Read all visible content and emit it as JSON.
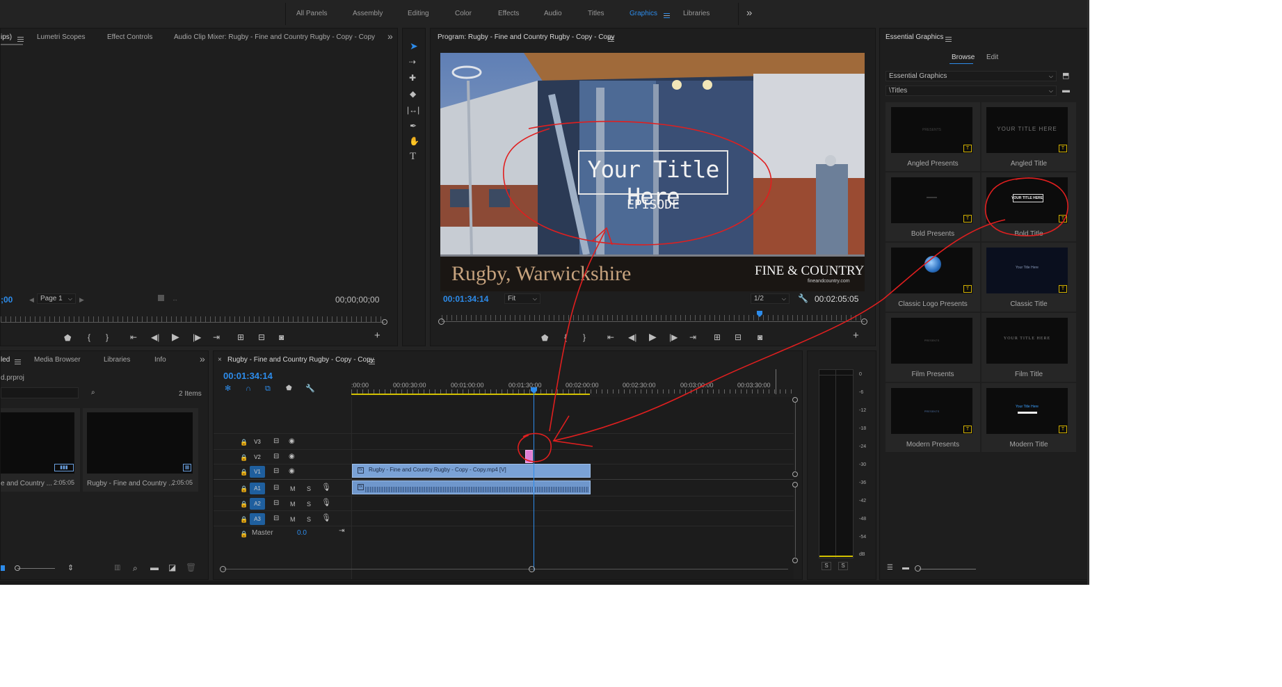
{
  "workspaces": [
    {
      "label": "All Panels",
      "active": false
    },
    {
      "label": "Assembly",
      "active": false
    },
    {
      "label": "Editing",
      "active": false
    },
    {
      "label": "Color",
      "active": false
    },
    {
      "label": "Effects",
      "active": false
    },
    {
      "label": "Audio",
      "active": false
    },
    {
      "label": "Titles",
      "active": false
    },
    {
      "label": "Graphics",
      "active": true
    },
    {
      "label": "Libraries",
      "active": false
    }
  ],
  "workspace_more": "»",
  "source_panel": {
    "tabs": [
      "ips)",
      "Lumetri Scopes",
      "Effect Controls",
      "Audio Clip Mixer: Rugby - Fine and Country Rugby - Copy - Copy"
    ],
    "more": "»",
    "timecode_left": ";00",
    "page_select": "Page 1",
    "timecode_right": "00;00;00;00"
  },
  "program_monitor": {
    "title": "Program: Rugby - Fine and Country Rugby - Copy - Copy",
    "title_text": "Your Title Here",
    "episode_text": "EPISODE",
    "location_text": "Rugby, Warwickshire",
    "brand_logo": "FINE & COUNTRY",
    "brand_sub": "fineandcountry.com",
    "current_time": "00:01:34:14",
    "fit": "Fit",
    "resolution": "1/2",
    "duration": "00:02:05:05"
  },
  "project_panel": {
    "tabs": [
      "led",
      "Media Browser",
      "Libraries",
      "Info"
    ],
    "more": "»",
    "filename": "d.prproj",
    "items_count": "2 Items",
    "items": [
      {
        "name": "e and Country ...",
        "duration": "2:05:05"
      },
      {
        "name": "Rugby - Fine and Country ...",
        "duration": "2:05:05"
      }
    ]
  },
  "timeline": {
    "sequence_name": "Rugby - Fine and Country Rugby - Copy - Copy",
    "timecode": "00:01:34:14",
    "ruler": [
      ":00:00",
      "00:00:30:00",
      "00:01:00:00",
      "00:01:30:00",
      "00:02:00:00",
      "00:02:30:00",
      "00:03:00:00",
      "00:03:30:00"
    ],
    "video_tracks": [
      "V3",
      "V2",
      "V1"
    ],
    "audio_tracks": [
      "A1",
      "A2",
      "A3"
    ],
    "master_label": "Master",
    "master_value": "0.0",
    "clip_label": "Rugby - Fine and Country Rugby - Copy - Copy.mp4 [V]",
    "mute": "M",
    "solo": "S"
  },
  "meter": {
    "scale": [
      "0",
      "-6",
      "-12",
      "-18",
      "-24",
      "-30",
      "-36",
      "-42",
      "-48",
      "-54",
      "dB"
    ],
    "solo_buttons": [
      "S",
      "S"
    ]
  },
  "essential_graphics": {
    "title": "Essential Graphics",
    "tabs": [
      "Browse",
      "Edit"
    ],
    "source_dropdown": "Essential Graphics",
    "folder_dropdown": "\\Titles",
    "templates": [
      {
        "name": "Angled Presents",
        "preview": "PRESENTS"
      },
      {
        "name": "Angled Title",
        "preview": "YOUR TITLE HERE"
      },
      {
        "name": "Bold Presents",
        "preview": "═══"
      },
      {
        "name": "Bold Title",
        "preview": "YOUR TITLE HERE"
      },
      {
        "name": "Classic Logo Presents",
        "preview": ""
      },
      {
        "name": "Classic Title",
        "preview": "Your Title Here"
      },
      {
        "name": "Film Presents",
        "preview": "PRESENTS"
      },
      {
        "name": "Film Title",
        "preview": "YOUR TITLE HERE"
      },
      {
        "name": "Modern Presents",
        "preview": "PRESENTS"
      },
      {
        "name": "Modern Title",
        "preview": "Your Title Here"
      }
    ]
  },
  "colors": {
    "accent": "#2d8ceb",
    "panel": "#1e1e1e",
    "clip": "#7aa2d6",
    "annotation": "#e01f1f"
  }
}
